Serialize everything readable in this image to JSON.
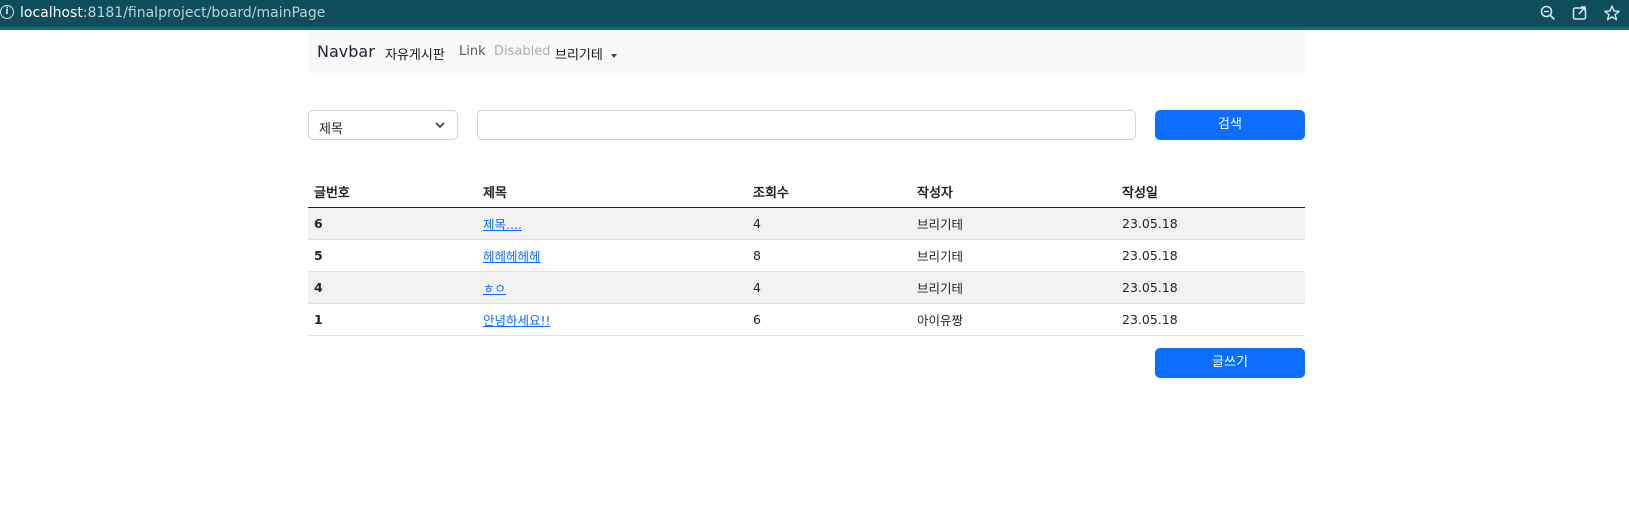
{
  "browser": {
    "url_host": "localhost",
    "url_rest": ":8181/finalproject/board/mainPage",
    "icons": [
      "zoom-icon",
      "share-icon",
      "bookmark-star-icon"
    ]
  },
  "navbar": {
    "brand": "Navbar",
    "links": [
      {
        "label": "자유게시판",
        "state": "active"
      },
      {
        "label": "Link",
        "state": "normal"
      },
      {
        "label": "Disabled",
        "state": "disabled"
      },
      {
        "label": "브리기테",
        "state": "dropdown"
      }
    ]
  },
  "search": {
    "select_value": "제목",
    "input_value": "",
    "button_label": "검색"
  },
  "table": {
    "headers": [
      "글번호",
      "제목",
      "조회수",
      "작성자",
      "작성일"
    ],
    "rows": [
      {
        "no": "6",
        "title": "제목....",
        "views": "4",
        "author": "브리기테",
        "date": "23.05.18"
      },
      {
        "no": "5",
        "title": "헤헤헤헤헤",
        "views": "8",
        "author": "브리기테",
        "date": "23.05.18"
      },
      {
        "no": "4",
        "title": "ㅎㅇ",
        "views": "4",
        "author": "브리기테",
        "date": "23.05.18"
      },
      {
        "no": "1",
        "title": "안녕하세요!!",
        "views": "6",
        "author": "아이유짱",
        "date": "23.05.18"
      }
    ]
  },
  "write_button_label": "글쓰기",
  "colors": {
    "primary": "#0d6efd",
    "urlbar": "#0f4c5c"
  }
}
